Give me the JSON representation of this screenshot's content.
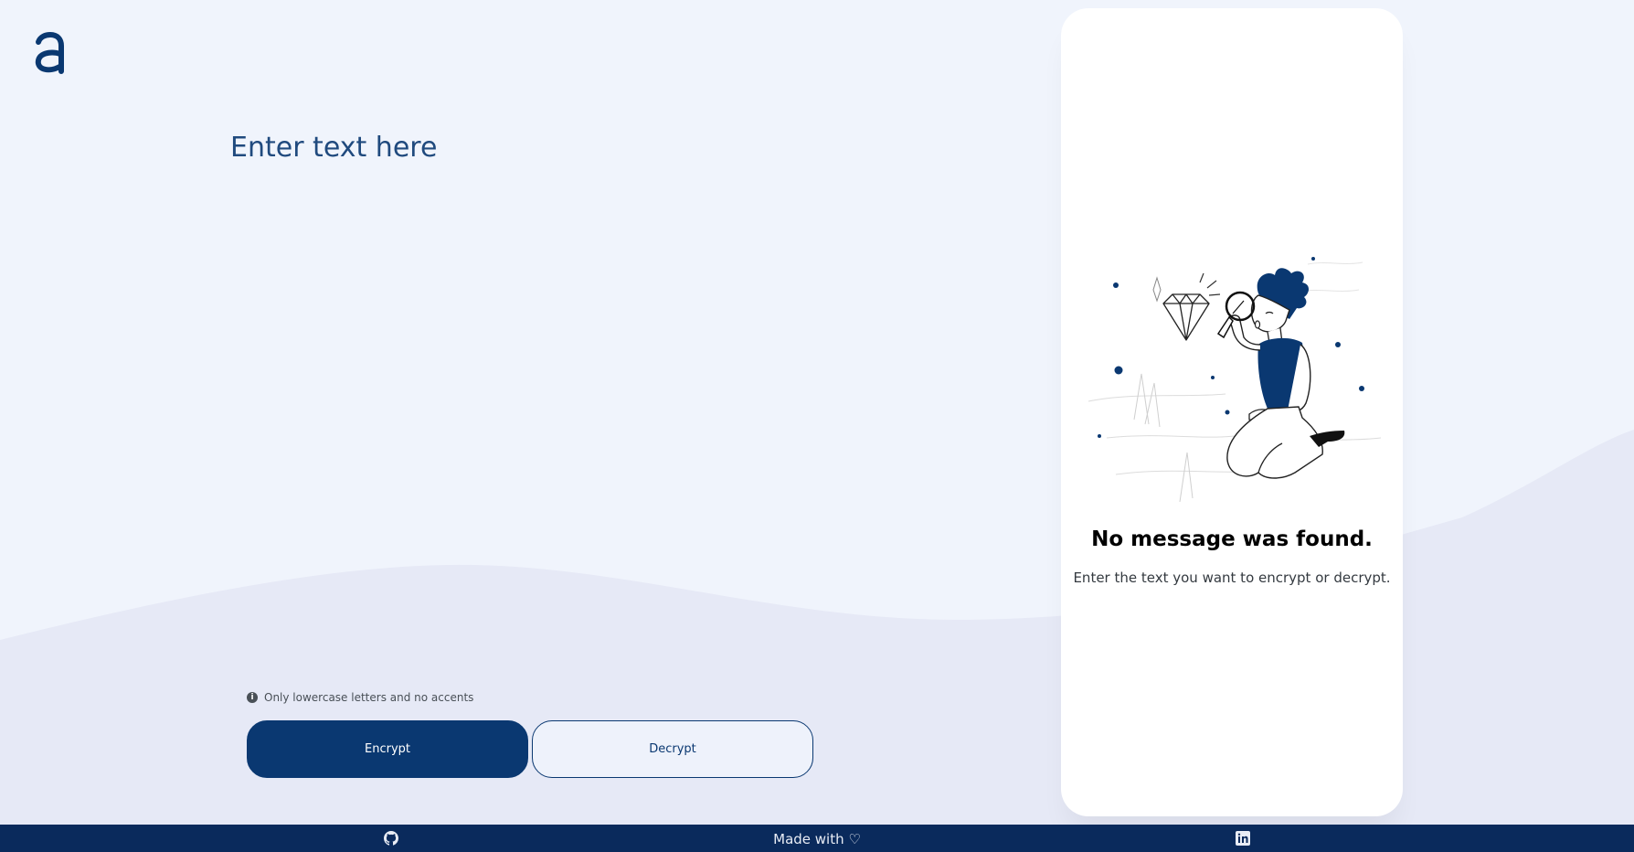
{
  "app": {
    "logo_icon": "alura-a-logo-icon",
    "accent_color": "#0a3871",
    "background_color": "#f0f4fc"
  },
  "editor": {
    "placeholder": "Enter text here",
    "value": ""
  },
  "hint": {
    "icon": "info-icon",
    "text": "Only lowercase letters and no accents"
  },
  "actions": {
    "encrypt_label": "Encrypt",
    "decrypt_label": "Decrypt"
  },
  "output_card": {
    "illustration": "person-with-magnifying-glass-and-diamond-illustration",
    "title": "No message was found.",
    "subtitle": "Enter the text you want to encrypt or decrypt."
  },
  "footer": {
    "github_icon": "github-icon",
    "made_with": "Made with",
    "heart_icon": "heart-icon",
    "linkedin_icon": "linkedin-icon",
    "background_color": "#0a2a5c"
  }
}
